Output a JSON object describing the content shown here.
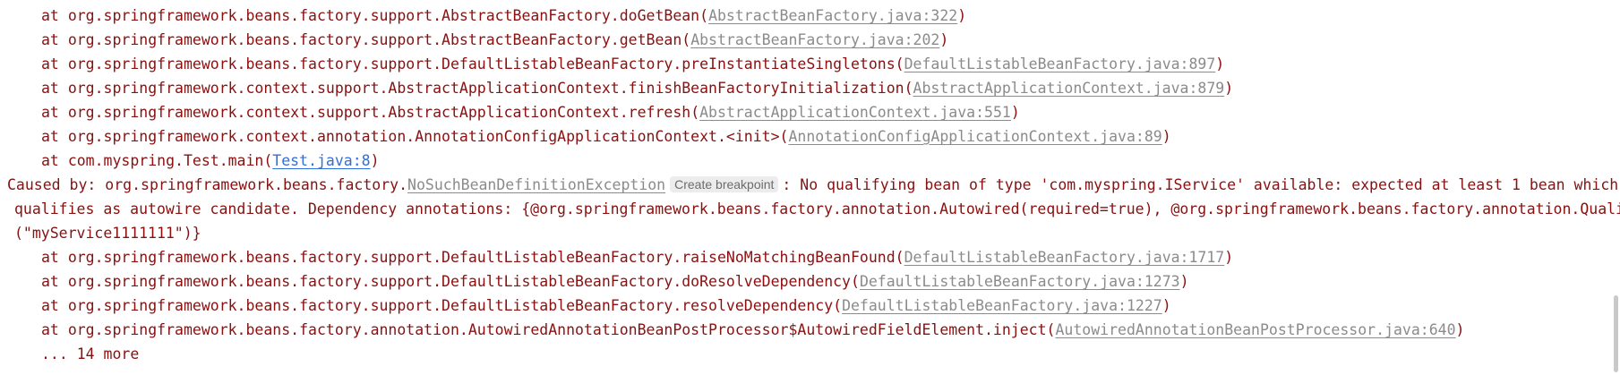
{
  "console": {
    "frames_top": [
      {
        "prefix": "at ",
        "method": "org.springframework.beans.factory.support.AbstractBeanFactory.doGetBean",
        "link": "AbstractBeanFactory.java:322"
      },
      {
        "prefix": "at ",
        "method": "org.springframework.beans.factory.support.AbstractBeanFactory.getBean",
        "link": "AbstractBeanFactory.java:202"
      },
      {
        "prefix": "at ",
        "method": "org.springframework.beans.factory.support.DefaultListableBeanFactory.preInstantiateSingletons",
        "link": "DefaultListableBeanFactory.java:897"
      },
      {
        "prefix": "at ",
        "method": "org.springframework.context.support.AbstractApplicationContext.finishBeanFactoryInitialization",
        "link": "AbstractApplicationContext.java:879"
      },
      {
        "prefix": "at ",
        "method": "org.springframework.context.support.AbstractApplicationContext.refresh",
        "link": "AbstractApplicationContext.java:551"
      },
      {
        "prefix": "at ",
        "method": "org.springframework.context.annotation.AnnotationConfigApplicationContext.<init>",
        "link": "AnnotationConfigApplicationContext.java:89"
      }
    ],
    "main_frame": {
      "prefix": "at ",
      "method": "com.myspring.Test.main",
      "link": "Test.java:8"
    },
    "caused_by": {
      "prefix": "Caused by: org.springframework.beans.factory.",
      "exception": "NoSuchBeanDefinitionException",
      "breakpoint_label": "Create breakpoint",
      "message_1": ": No qualifying bean of type 'com.myspring.IService' available: expected at least 1 bean which",
      "message_2": "qualifies as autowire candidate. Dependency annotations: {@org.springframework.beans.factory.annotation.Autowired(required=true), @org.springframework.beans.factory.annotation.Qualifier",
      "message_3": "(\"myService1111111\")}"
    },
    "frames_bottom": [
      {
        "prefix": "at ",
        "method": "org.springframework.beans.factory.support.DefaultListableBeanFactory.raiseNoMatchingBeanFound",
        "link": "DefaultListableBeanFactory.java:1717"
      },
      {
        "prefix": "at ",
        "method": "org.springframework.beans.factory.support.DefaultListableBeanFactory.doResolveDependency",
        "link": "DefaultListableBeanFactory.java:1273"
      },
      {
        "prefix": "at ",
        "method": "org.springframework.beans.factory.support.DefaultListableBeanFactory.resolveDependency",
        "link": "DefaultListableBeanFactory.java:1227"
      },
      {
        "prefix": "at ",
        "method": "org.springframework.beans.factory.annotation.AutowiredAnnotationBeanPostProcessor$AutowiredFieldElement.inject",
        "link": "AutowiredAnnotationBeanPostProcessor.java:640"
      }
    ],
    "more": "... 14 more"
  },
  "colors": {
    "text": "#8a1010",
    "link_gray": "#8b8b8b",
    "link_blue": "#2f6fdd",
    "badge_bg": "#ececec"
  }
}
